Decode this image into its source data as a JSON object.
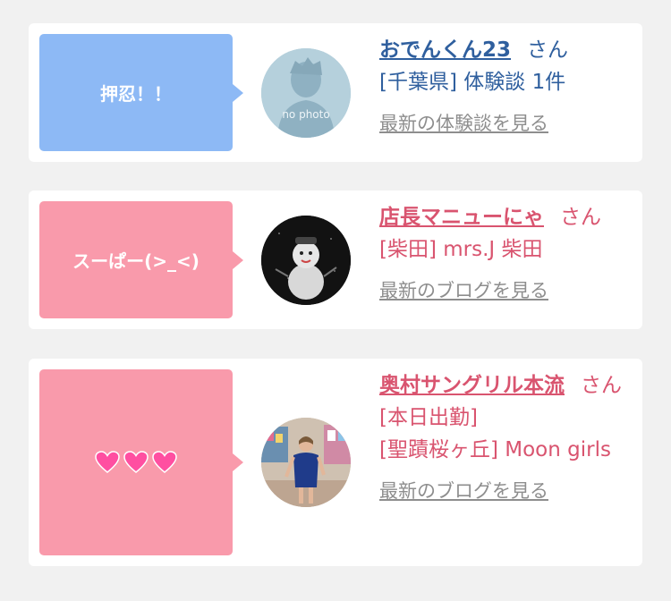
{
  "cards": [
    {
      "bubble_text": "押忍！！",
      "name": "おでんくん23",
      "suffix": "さん",
      "line2": "[千葉県] 体験談 1件",
      "link": "最新の体験談を見る",
      "avatar_text": "no photo",
      "accent": "#8db9f5"
    },
    {
      "bubble_text": "スーぱー(>_<)",
      "name": "店長マニューにゃ",
      "suffix": "さん",
      "line2": "[柴田] mrs.J 柴田",
      "link": "最新のブログを見る",
      "accent": "#f99aab"
    },
    {
      "bubble_icons": [
        "heart-icon",
        "heart-icon",
        "heart-icon"
      ],
      "name": "奥村サングリル本流",
      "suffix": "さん",
      "line2": "[本日出勤]",
      "line3": "[聖蹟桜ヶ丘] Moon girls",
      "link": "最新のブログを見る",
      "accent": "#f99aab"
    }
  ],
  "colors": {
    "background": "#f1f1f1",
    "card": "#ffffff",
    "blue_text": "#2f5f9e",
    "pink_text": "#d9546f",
    "link": "#8e8e8e"
  }
}
